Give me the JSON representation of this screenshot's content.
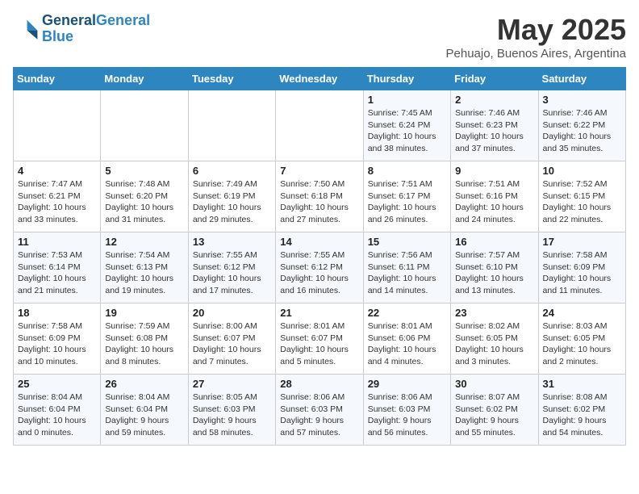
{
  "header": {
    "logo_line1": "General",
    "logo_line2": "Blue",
    "month": "May 2025",
    "location": "Pehuajo, Buenos Aires, Argentina"
  },
  "weekdays": [
    "Sunday",
    "Monday",
    "Tuesday",
    "Wednesday",
    "Thursday",
    "Friday",
    "Saturday"
  ],
  "weeks": [
    [
      {
        "day": "",
        "info": ""
      },
      {
        "day": "",
        "info": ""
      },
      {
        "day": "",
        "info": ""
      },
      {
        "day": "",
        "info": ""
      },
      {
        "day": "1",
        "info": "Sunrise: 7:45 AM\nSunset: 6:24 PM\nDaylight: 10 hours\nand 38 minutes."
      },
      {
        "day": "2",
        "info": "Sunrise: 7:46 AM\nSunset: 6:23 PM\nDaylight: 10 hours\nand 37 minutes."
      },
      {
        "day": "3",
        "info": "Sunrise: 7:46 AM\nSunset: 6:22 PM\nDaylight: 10 hours\nand 35 minutes."
      }
    ],
    [
      {
        "day": "4",
        "info": "Sunrise: 7:47 AM\nSunset: 6:21 PM\nDaylight: 10 hours\nand 33 minutes."
      },
      {
        "day": "5",
        "info": "Sunrise: 7:48 AM\nSunset: 6:20 PM\nDaylight: 10 hours\nand 31 minutes."
      },
      {
        "day": "6",
        "info": "Sunrise: 7:49 AM\nSunset: 6:19 PM\nDaylight: 10 hours\nand 29 minutes."
      },
      {
        "day": "7",
        "info": "Sunrise: 7:50 AM\nSunset: 6:18 PM\nDaylight: 10 hours\nand 27 minutes."
      },
      {
        "day": "8",
        "info": "Sunrise: 7:51 AM\nSunset: 6:17 PM\nDaylight: 10 hours\nand 26 minutes."
      },
      {
        "day": "9",
        "info": "Sunrise: 7:51 AM\nSunset: 6:16 PM\nDaylight: 10 hours\nand 24 minutes."
      },
      {
        "day": "10",
        "info": "Sunrise: 7:52 AM\nSunset: 6:15 PM\nDaylight: 10 hours\nand 22 minutes."
      }
    ],
    [
      {
        "day": "11",
        "info": "Sunrise: 7:53 AM\nSunset: 6:14 PM\nDaylight: 10 hours\nand 21 minutes."
      },
      {
        "day": "12",
        "info": "Sunrise: 7:54 AM\nSunset: 6:13 PM\nDaylight: 10 hours\nand 19 minutes."
      },
      {
        "day": "13",
        "info": "Sunrise: 7:55 AM\nSunset: 6:12 PM\nDaylight: 10 hours\nand 17 minutes."
      },
      {
        "day": "14",
        "info": "Sunrise: 7:55 AM\nSunset: 6:12 PM\nDaylight: 10 hours\nand 16 minutes."
      },
      {
        "day": "15",
        "info": "Sunrise: 7:56 AM\nSunset: 6:11 PM\nDaylight: 10 hours\nand 14 minutes."
      },
      {
        "day": "16",
        "info": "Sunrise: 7:57 AM\nSunset: 6:10 PM\nDaylight: 10 hours\nand 13 minutes."
      },
      {
        "day": "17",
        "info": "Sunrise: 7:58 AM\nSunset: 6:09 PM\nDaylight: 10 hours\nand 11 minutes."
      }
    ],
    [
      {
        "day": "18",
        "info": "Sunrise: 7:58 AM\nSunset: 6:09 PM\nDaylight: 10 hours\nand 10 minutes."
      },
      {
        "day": "19",
        "info": "Sunrise: 7:59 AM\nSunset: 6:08 PM\nDaylight: 10 hours\nand 8 minutes."
      },
      {
        "day": "20",
        "info": "Sunrise: 8:00 AM\nSunset: 6:07 PM\nDaylight: 10 hours\nand 7 minutes."
      },
      {
        "day": "21",
        "info": "Sunrise: 8:01 AM\nSunset: 6:07 PM\nDaylight: 10 hours\nand 5 minutes."
      },
      {
        "day": "22",
        "info": "Sunrise: 8:01 AM\nSunset: 6:06 PM\nDaylight: 10 hours\nand 4 minutes."
      },
      {
        "day": "23",
        "info": "Sunrise: 8:02 AM\nSunset: 6:05 PM\nDaylight: 10 hours\nand 3 minutes."
      },
      {
        "day": "24",
        "info": "Sunrise: 8:03 AM\nSunset: 6:05 PM\nDaylight: 10 hours\nand 2 minutes."
      }
    ],
    [
      {
        "day": "25",
        "info": "Sunrise: 8:04 AM\nSunset: 6:04 PM\nDaylight: 10 hours\nand 0 minutes."
      },
      {
        "day": "26",
        "info": "Sunrise: 8:04 AM\nSunset: 6:04 PM\nDaylight: 9 hours\nand 59 minutes."
      },
      {
        "day": "27",
        "info": "Sunrise: 8:05 AM\nSunset: 6:03 PM\nDaylight: 9 hours\nand 58 minutes."
      },
      {
        "day": "28",
        "info": "Sunrise: 8:06 AM\nSunset: 6:03 PM\nDaylight: 9 hours\nand 57 minutes."
      },
      {
        "day": "29",
        "info": "Sunrise: 8:06 AM\nSunset: 6:03 PM\nDaylight: 9 hours\nand 56 minutes."
      },
      {
        "day": "30",
        "info": "Sunrise: 8:07 AM\nSunset: 6:02 PM\nDaylight: 9 hours\nand 55 minutes."
      },
      {
        "day": "31",
        "info": "Sunrise: 8:08 AM\nSunset: 6:02 PM\nDaylight: 9 hours\nand 54 minutes."
      }
    ]
  ]
}
